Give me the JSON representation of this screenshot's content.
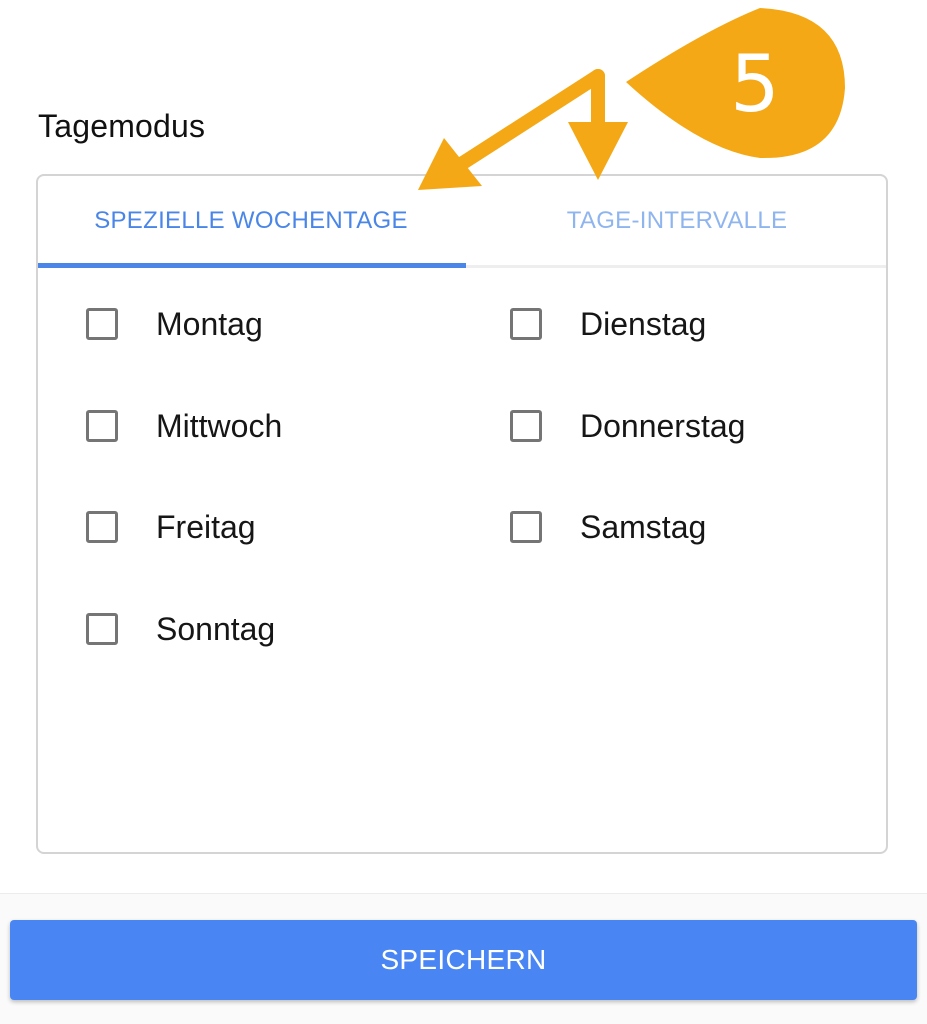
{
  "header": {
    "title": "Tagemodus"
  },
  "tabs": [
    {
      "label": "SPEZIELLE WOCHENTAGE",
      "active": true
    },
    {
      "label": "TAGE-INTERVALLE",
      "active": false
    }
  ],
  "days": [
    {
      "label": "Montag",
      "checked": false
    },
    {
      "label": "Dienstag",
      "checked": false
    },
    {
      "label": "Mittwoch",
      "checked": false
    },
    {
      "label": "Donnerstag",
      "checked": false
    },
    {
      "label": "Freitag",
      "checked": false
    },
    {
      "label": "Samstag",
      "checked": false
    },
    {
      "label": "Sonntag",
      "checked": false
    }
  ],
  "save_button": {
    "label": "SPEICHERN"
  },
  "annotation": {
    "number": "5",
    "color": "#f5a815"
  },
  "colors": {
    "accent": "#4a86e8",
    "button": "#4a86f3"
  }
}
